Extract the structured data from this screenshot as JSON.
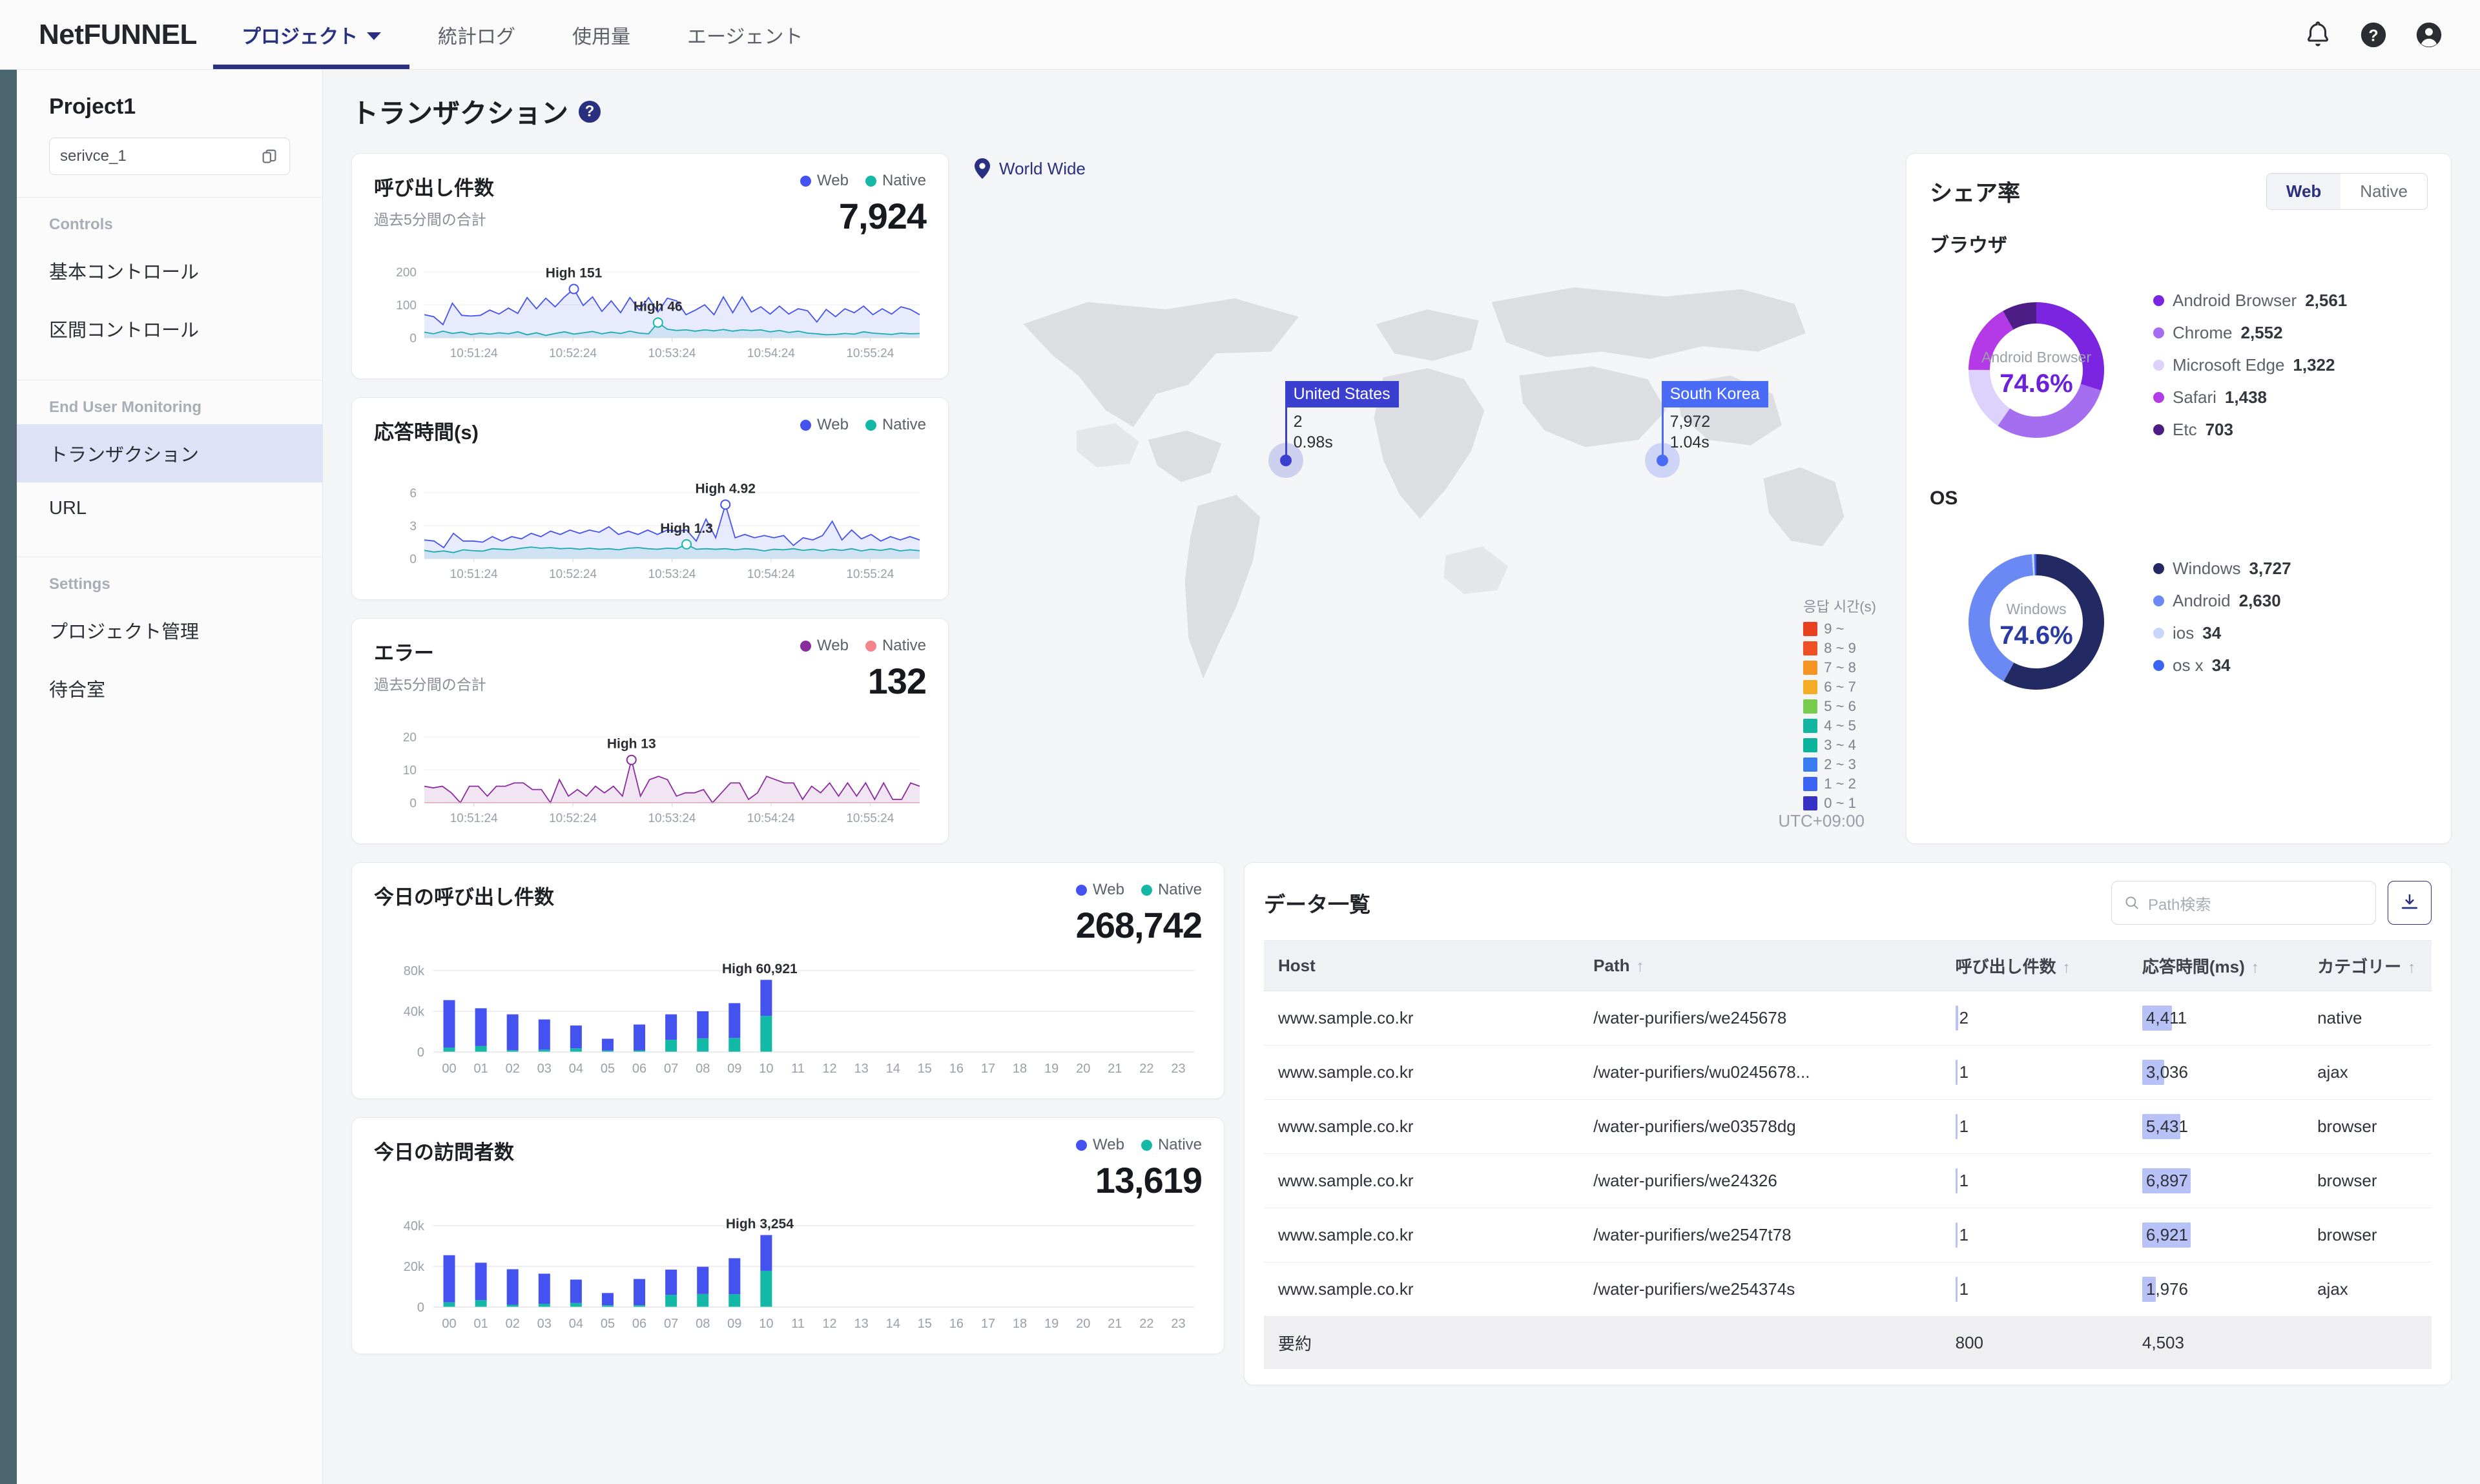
{
  "brand": "NetFUNNEL",
  "nav": [
    {
      "label": "プロジェクト",
      "active": true,
      "caret": true
    },
    {
      "label": "統計ログ",
      "active": false,
      "caret": false
    },
    {
      "label": "使用量",
      "active": false,
      "caret": false
    },
    {
      "label": "エージェント",
      "active": false,
      "caret": false
    }
  ],
  "topbar_icons": [
    "bell-icon",
    "help-icon",
    "account-icon"
  ],
  "sidebar": {
    "project": "Project1",
    "service_value": "serivce_1",
    "groups": [
      {
        "label": "Controls",
        "items": [
          {
            "label": "基本コントロール",
            "active": false
          },
          {
            "label": "区間コントロール",
            "active": false
          }
        ]
      },
      {
        "label": "End User Monitoring",
        "items": [
          {
            "label": "トランザクション",
            "active": true
          },
          {
            "label": "URL",
            "active": false
          }
        ]
      },
      {
        "label": "Settings",
        "items": [
          {
            "label": "プロジェクト管理",
            "active": false
          },
          {
            "label": "待合室",
            "active": false
          }
        ]
      }
    ]
  },
  "page": {
    "title": "トランザクション"
  },
  "cards": {
    "calls": {
      "title": "呼び出し件数",
      "subtitle": "過去5分間の合計",
      "value": "7,924",
      "legend": [
        {
          "label": "Web",
          "color": "#4452f0"
        },
        {
          "label": "Native",
          "color": "#14b8a6"
        }
      ],
      "high_web": "High 151",
      "high_native": "High 46"
    },
    "resp": {
      "title": "応答時間(s)",
      "subtitle": "",
      "value": "",
      "legend": [
        {
          "label": "Web",
          "color": "#4452f0"
        },
        {
          "label": "Native",
          "color": "#14b8a6"
        }
      ],
      "high_web": "High 4.92",
      "high_native": "High 1.3"
    },
    "error": {
      "title": "エラー",
      "subtitle": "過去5分間の合計",
      "value": "132",
      "legend": [
        {
          "label": "Web",
          "color": "#8b2c9e"
        },
        {
          "label": "Native",
          "color": "#f4848b"
        }
      ],
      "high_web": "High 13"
    },
    "today_calls": {
      "title": "今日の呼び出し件数",
      "value": "268,742",
      "high": "High 60,921",
      "legend": [
        {
          "label": "Web",
          "color": "#4452f0"
        },
        {
          "label": "Native",
          "color": "#14b8a6"
        }
      ]
    },
    "today_visitors": {
      "title": "今日の訪問者数",
      "value": "13,619",
      "high": "High 3,254",
      "legend": [
        {
          "label": "Web",
          "color": "#4452f0"
        },
        {
          "label": "Native",
          "color": "#14b8a6"
        }
      ]
    }
  },
  "map": {
    "world_wide": "World Wide",
    "utc": "UTC+09:00",
    "legend_title": "응답 시간(s)",
    "legend": [
      {
        "label": "9 ~",
        "color": "#e8401f"
      },
      {
        "label": "8 ~ 9",
        "color": "#ee4f23"
      },
      {
        "label": "7 ~ 8",
        "color": "#f59422"
      },
      {
        "label": "6 ~ 7",
        "color": "#f5ad27"
      },
      {
        "label": "5 ~ 6",
        "color": "#77cc4e"
      },
      {
        "label": "4 ~ 5",
        "color": "#12b5a0"
      },
      {
        "label": "3 ~ 4",
        "color": "#09b49b"
      },
      {
        "label": "2 ~ 3",
        "color": "#3a7bf0"
      },
      {
        "label": "1 ~ 2",
        "color": "#3b64f5"
      },
      {
        "label": "0 ~ 1",
        "color": "#3730c4"
      }
    ],
    "tooltips": [
      {
        "name": "United States",
        "count": "2",
        "time": "0.98s",
        "head_color": "#3b3fd0"
      },
      {
        "name": "South Korea",
        "count": "7,972",
        "time": "1.04s",
        "head_color": "#4a6bf5"
      }
    ]
  },
  "share": {
    "title": "シェア率",
    "tabs": [
      {
        "label": "Web",
        "on": true
      },
      {
        "label": "Native",
        "on": false
      }
    ],
    "browser": {
      "section": "ブラウザ",
      "center_label": "Android Browser",
      "center_value": "74.6%",
      "items": [
        {
          "label": "Android Browser",
          "value": "2,561",
          "color": "#7b25e0"
        },
        {
          "label": "Chrome",
          "value": "2,552",
          "color": "#a56df0"
        },
        {
          "label": "Microsoft Edge",
          "value": "1,322",
          "color": "#ddd2fb"
        },
        {
          "label": "Safari",
          "value": "1,438",
          "color": "#b43ae8"
        },
        {
          "label": "Etc",
          "value": "703",
          "color": "#4c1d84"
        }
      ]
    },
    "os": {
      "section": "OS",
      "center_label": "Windows",
      "center_value": "74.6%",
      "items": [
        {
          "label": "Windows",
          "value": "3,727",
          "color": "#232a63"
        },
        {
          "label": "Android",
          "value": "2,630",
          "color": "#6b89f5"
        },
        {
          "label": "ios",
          "value": "34",
          "color": "#c9d6fb"
        },
        {
          "label": "os x",
          "value": "34",
          "color": "#3b64f5"
        }
      ]
    }
  },
  "table": {
    "title": "データ一覧",
    "search_placeholder": "Path検索",
    "download_icon": "download-icon",
    "columns": [
      "Host",
      "Path",
      "呼び出し件数",
      "応答時間(ms)",
      "カテゴリー"
    ],
    "rows": [
      {
        "host": "www.sample.co.kr",
        "path": "/water-purifiers/we245678",
        "calls": "2",
        "resp": "4,411",
        "cat": "native",
        "calls_pct": 4,
        "resp_pct": 62
      },
      {
        "host": "www.sample.co.kr",
        "path": "/water-purifiers/wu0245678...",
        "calls": "1",
        "resp": "3,036",
        "cat": "ajax",
        "calls_pct": 2,
        "resp_pct": 44
      },
      {
        "host": "www.sample.co.kr",
        "path": "/water-purifiers/we03578dg",
        "calls": "1",
        "resp": "5,431",
        "cat": "browser",
        "calls_pct": 2,
        "resp_pct": 77
      },
      {
        "host": "www.sample.co.kr",
        "path": "/water-purifiers/we24326",
        "calls": "1",
        "resp": "6,897",
        "cat": "browser",
        "calls_pct": 2,
        "resp_pct": 97
      },
      {
        "host": "www.sample.co.kr",
        "path": "/water-purifiers/we2547t78",
        "calls": "1",
        "resp": "6,921",
        "cat": "browser",
        "calls_pct": 2,
        "resp_pct": 98
      },
      {
        "host": "www.sample.co.kr",
        "path": "/water-purifiers/we254374s",
        "calls": "1",
        "resp": "1,976",
        "cat": "ajax",
        "calls_pct": 2,
        "resp_pct": 28
      }
    ],
    "summary": {
      "label": "要約",
      "calls": "800",
      "resp": "4,503"
    }
  },
  "chart_data": [
    {
      "type": "line",
      "title": "呼び出し件数",
      "ylabel": "",
      "xlabel": "",
      "ylim": [
        0,
        200
      ],
      "yticks": [
        0,
        100,
        200
      ],
      "xticks": [
        "10:51:24",
        "10:52:24",
        "10:53:24",
        "10:54:24",
        "10:55:24"
      ],
      "annotations": [
        "High 151",
        "High 46"
      ],
      "series": [
        {
          "name": "Web",
          "color": "#4452f0",
          "values": [
            70,
            64,
            40,
            105,
            68,
            66,
            68,
            84,
            72,
            90,
            74,
            122,
            88,
            120,
            94,
            124,
            148,
            98,
            124,
            80,
            112,
            76,
            122,
            84,
            122,
            78,
            120,
            112,
            70,
            84,
            100,
            70,
            124,
            76,
            124,
            78,
            94,
            72,
            96,
            72,
            88,
            82,
            48,
            86,
            64,
            88,
            76,
            96,
            70,
            88,
            72,
            94,
            86,
            70
          ]
        },
        {
          "name": "Native",
          "color": "#14b8a6",
          "values": [
            17,
            12,
            20,
            13,
            17,
            10,
            14,
            11,
            15,
            12,
            18,
            9,
            15,
            7,
            13,
            18,
            11,
            15,
            19,
            12,
            17,
            13,
            20,
            14,
            12,
            46,
            26,
            22,
            24,
            20,
            24,
            21,
            25,
            20,
            24,
            22,
            24,
            18,
            22,
            16,
            20,
            14,
            12,
            9,
            10,
            13,
            11,
            18,
            14,
            12,
            10,
            14,
            12,
            13
          ]
        }
      ]
    },
    {
      "type": "line",
      "title": "応答時間(s)",
      "ylim": [
        0,
        6
      ],
      "yticks": [
        0,
        3,
        6
      ],
      "xticks": [
        "10:51:24",
        "10:52:24",
        "10:53:24",
        "10:54:24",
        "10:55:24"
      ],
      "annotations": [
        "High 4.92",
        "High 1.3"
      ],
      "series": [
        {
          "name": "Web",
          "color": "#4452f0",
          "values": [
            1.7,
            1.6,
            1.0,
            2.3,
            1.6,
            1.6,
            1.5,
            2.0,
            1.6,
            2.0,
            1.8,
            2.3,
            2.0,
            2.5,
            2.2,
            2.6,
            2.3,
            2.6,
            2.4,
            2.9,
            2.2,
            2.5,
            2.2,
            2.6,
            2.2,
            2.6,
            2.5,
            2.6,
            1.6,
            3.6,
            1.9,
            4.92,
            1.9,
            2.2,
            1.9,
            2.1,
            1.9,
            2.1,
            1.2,
            1.9,
            1.7,
            2.1,
            3.4,
            1.7,
            2.6,
            1.8,
            2.2,
            1.6,
            2.0,
            1.7,
            2.0,
            1.7
          ]
        },
        {
          "name": "Native",
          "color": "#14b8a6",
          "values": [
            0.75,
            0.6,
            0.7,
            0.55,
            0.8,
            0.72,
            0.68,
            0.9,
            0.85,
            0.8,
            0.95,
            1.05,
            0.95,
            1.0,
            0.9,
            0.95,
            0.85,
            0.95,
            0.85,
            0.9,
            0.8,
            0.95,
            1.0,
            0.9,
            0.85,
            0.95,
            0.9,
            1.3,
            0.85,
            0.9,
            0.85,
            0.9,
            0.8,
            0.9,
            0.85,
            0.7,
            0.85,
            0.8,
            0.9,
            0.75,
            0.85,
            0.7,
            0.85,
            0.75,
            0.9,
            0.7,
            0.85,
            0.75,
            0.9,
            0.7,
            0.8,
            0.72
          ]
        }
      ]
    },
    {
      "type": "line",
      "title": "エラー",
      "ylim": [
        0,
        20
      ],
      "yticks": [
        0,
        10,
        20
      ],
      "xticks": [
        "10:51:24",
        "10:52:24",
        "10:53:24",
        "10:54:24",
        "10:55:24"
      ],
      "annotations": [
        "High 13"
      ],
      "series": [
        {
          "name": "Web",
          "color": "#8b2c9e",
          "values": [
            5,
            4.5,
            5,
            3,
            0,
            5,
            5,
            2,
            5,
            5,
            6,
            6,
            4,
            4,
            0,
            7,
            2,
            4,
            2,
            5,
            3,
            5,
            2,
            13,
            2,
            7,
            8,
            7,
            2,
            3,
            3,
            4,
            0,
            3,
            6,
            6,
            1,
            3,
            8,
            7,
            6,
            6,
            1,
            5,
            3,
            6,
            2,
            6,
            2,
            6,
            1,
            6,
            1,
            1,
            6,
            5
          ]
        },
        {
          "name": "Native",
          "color": "#f4848b",
          "values": [
            0,
            0,
            0,
            0,
            0,
            0,
            0,
            0,
            0,
            0,
            0,
            0,
            0,
            0,
            0,
            0,
            0,
            0,
            0,
            0,
            0,
            0,
            0,
            0,
            0,
            0,
            0,
            0,
            0,
            0,
            0,
            0,
            0,
            0,
            0,
            0,
            0,
            0,
            0,
            0,
            0,
            0,
            0,
            0,
            0,
            0,
            0,
            0,
            0,
            0,
            0,
            0,
            0,
            0,
            0,
            0
          ]
        }
      ]
    },
    {
      "type": "bar",
      "title": "今日の呼び出し件数",
      "ylim": [
        0,
        80000
      ],
      "yticks": [
        "0",
        "40k",
        "80k"
      ],
      "categories": [
        "00",
        "01",
        "02",
        "03",
        "04",
        "05",
        "06",
        "07",
        "08",
        "09",
        "10",
        "11",
        "12",
        "13",
        "14",
        "15",
        "16",
        "17",
        "18",
        "19",
        "20",
        "21",
        "22",
        "23"
      ],
      "annotation": "High 60,921",
      "series": [
        {
          "name": "Native",
          "color": "#14b8a6",
          "values": [
            4200,
            5800,
            1800,
            2300,
            3600,
            1400,
            1600,
            12000,
            13500,
            13800,
            35500,
            0,
            0,
            0,
            0,
            0,
            0,
            0,
            0,
            0,
            0,
            0,
            0,
            0
          ]
        },
        {
          "name": "Web",
          "color": "#4452f0",
          "values": [
            46800,
            37200,
            35200,
            29700,
            22400,
            11600,
            25400,
            25000,
            26500,
            34200,
            35400,
            0,
            0,
            0,
            0,
            0,
            0,
            0,
            0,
            0,
            0,
            0,
            0,
            0
          ]
        }
      ]
    },
    {
      "type": "bar",
      "title": "今日の訪問者数",
      "ylim": [
        0,
        40000
      ],
      "yticks": [
        "0",
        "20k",
        "40k"
      ],
      "categories": [
        "00",
        "01",
        "02",
        "03",
        "04",
        "05",
        "06",
        "07",
        "08",
        "09",
        "10",
        "11",
        "12",
        "13",
        "14",
        "15",
        "16",
        "17",
        "18",
        "19",
        "20",
        "21",
        "22",
        "23"
      ],
      "annotation": "High 3,254",
      "series": [
        {
          "name": "Native",
          "color": "#14b8a6",
          "values": [
            2300,
            3400,
            1100,
            1600,
            2000,
            900,
            900,
            6000,
            6400,
            6300,
            17800,
            0,
            0,
            0,
            0,
            0,
            0,
            0,
            0,
            0,
            0,
            0,
            0,
            0
          ]
        },
        {
          "name": "Web",
          "color": "#4452f0",
          "values": [
            23200,
            18400,
            17500,
            14800,
            11500,
            6000,
            12900,
            12400,
            13400,
            17700,
            17600,
            0,
            0,
            0,
            0,
            0,
            0,
            0,
            0,
            0,
            0,
            0,
            0,
            0
          ]
        }
      ]
    },
    {
      "type": "pie",
      "title": "ブラウザ",
      "labels": [
        "Android Browser",
        "Chrome",
        "Microsoft Edge",
        "Safari",
        "Etc"
      ],
      "values": [
        2561,
        2552,
        1322,
        1438,
        703
      ],
      "colors": [
        "#7b25e0",
        "#a56df0",
        "#ddd2fb",
        "#b43ae8",
        "#4c1d84"
      ],
      "center": "74.6%"
    },
    {
      "type": "pie",
      "title": "OS",
      "labels": [
        "Windows",
        "Android",
        "ios",
        "os x"
      ],
      "values": [
        3727,
        2630,
        34,
        34
      ],
      "colors": [
        "#232a63",
        "#6b89f5",
        "#c9d6fb",
        "#3b64f5"
      ],
      "center": "74.6%"
    }
  ]
}
